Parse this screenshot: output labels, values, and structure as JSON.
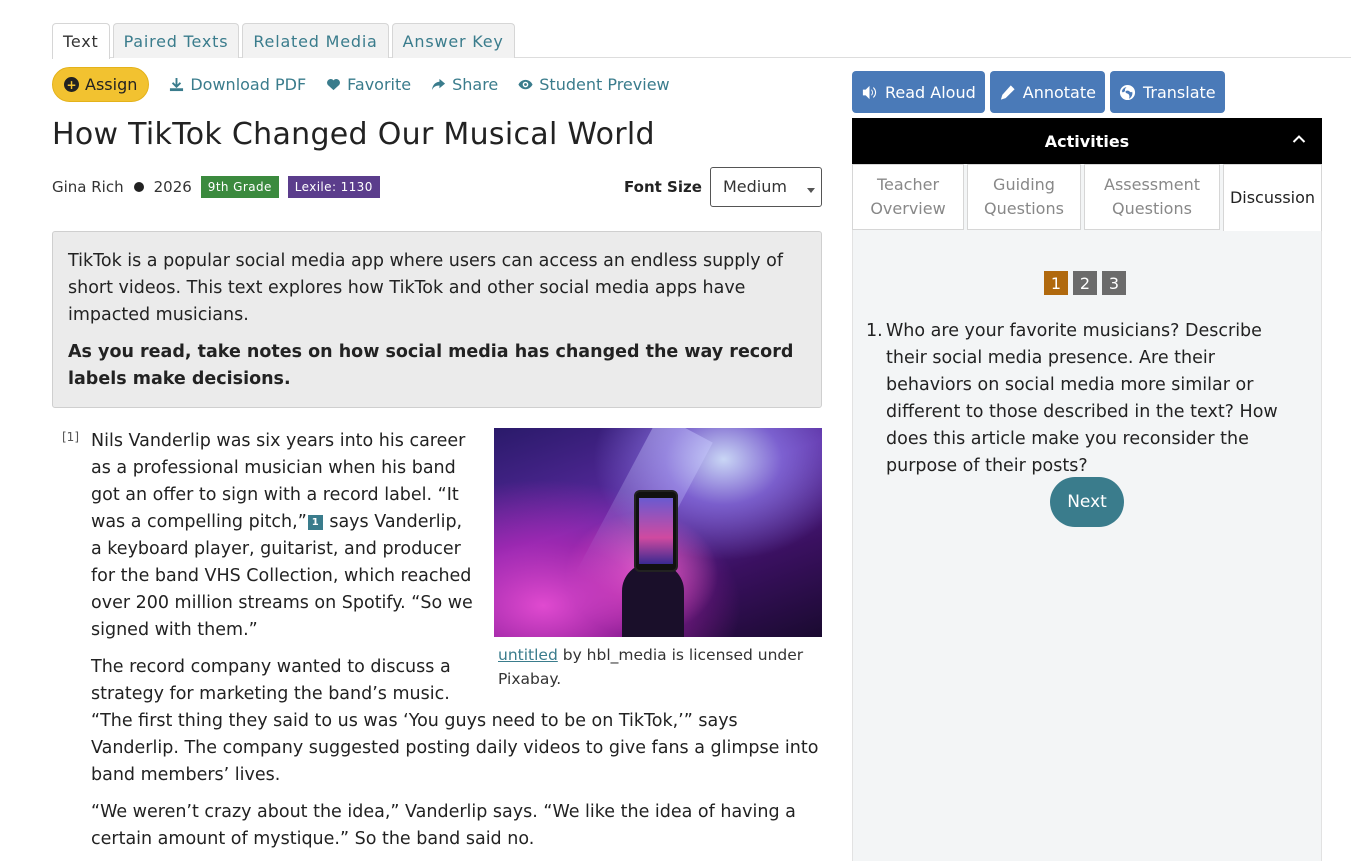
{
  "tabs": [
    {
      "label": "Text",
      "active": true
    },
    {
      "label": "Paired Texts",
      "active": false
    },
    {
      "label": "Related Media",
      "active": false
    },
    {
      "label": "Answer Key",
      "active": false
    }
  ],
  "actions": {
    "assign": "Assign",
    "download_pdf": "Download PDF",
    "favorite": "Favorite",
    "share": "Share",
    "student_preview": "Student Preview"
  },
  "title": "How TikTok Changed Our Musical World",
  "meta": {
    "author": "Gina Rich",
    "year": "2026",
    "grade": "9th Grade",
    "lexile": "Lexile: 1130"
  },
  "font_size": {
    "label": "Font Size",
    "value": "Medium"
  },
  "intro": {
    "summary": "TikTok is a popular social media app where users can access an endless supply of short videos. This text explores how TikTok and other social media apps have impacted musicians.",
    "instruction": "As you read, take notes on how social media has changed the way record labels make decisions."
  },
  "article": {
    "para_number": "[1]",
    "p1_before": "Nils Vanderlip was six years into his career as a professional musician when his band got an offer to sign with a record label. “It was a compelling pitch,”",
    "footnote": "1",
    "p1_after": " says Vanderlip, a keyboard player, guitarist, and producer for the band VHS Collection, which reached over 200 million streams on Spotify. “So we signed with them.”",
    "p2": "The record company wanted to discuss a strategy for marketing the band’s music. “The first thing they said to us was ‘You guys need to be on TikTok,’” says Vanderlip. The company suggested posting daily videos to give fans a glimpse into band members’ lives.",
    "p3": "“We weren’t crazy about the idea,” Vanderlip says. “We like the idea of having a certain amount of mystique.” So the band said no.",
    "image_caption_link": "untitled",
    "image_caption_rest": " by hbl_media is licensed under Pixabay."
  },
  "tools": {
    "read_aloud": "Read Aloud",
    "annotate": "Annotate",
    "translate": "Translate"
  },
  "activities": {
    "header": "Activities",
    "subtabs": [
      {
        "label": "Teacher Overview",
        "active": false
      },
      {
        "label": "Guiding Questions",
        "active": false
      },
      {
        "label": "Assessment Questions",
        "active": false
      },
      {
        "label": "Discussion",
        "active": true
      }
    ],
    "pages": [
      "1",
      "2",
      "3"
    ],
    "active_page": "1",
    "question_number": "1.",
    "question": "Who are your favorite musicians? Describe their social media presence. Are their behaviors on social media more similar or different to those described in the text? How does this article make you reconsider the purpose of their posts?",
    "next": "Next"
  },
  "colors": {
    "accent": "#3a7c8c",
    "assign": "#f2c230",
    "tool_button": "#4a7ab8",
    "grade_badge": "#3b8a3e",
    "lexile_badge": "#5b3d8c",
    "active_page": "#b0690e"
  }
}
